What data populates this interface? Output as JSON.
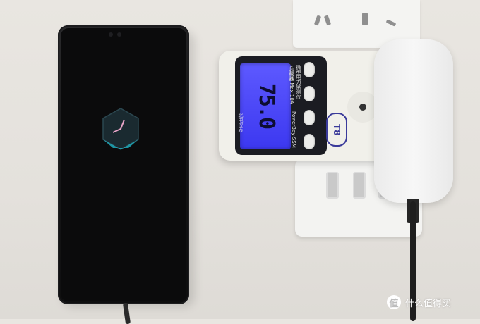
{
  "meter": {
    "display_value": "75.0",
    "brand_label": "北电仪表",
    "product_label": "微型电力监测仪",
    "rating_label": "负载器 Max 10A",
    "model_line": "PowerBay-SSM",
    "model_badge": "T8"
  },
  "watermark": {
    "logo": "值",
    "text": "什么值得买"
  },
  "colors": {
    "lcd": "#4a46f5",
    "meter_body": "#f1f0ea",
    "phone": "#111112"
  }
}
